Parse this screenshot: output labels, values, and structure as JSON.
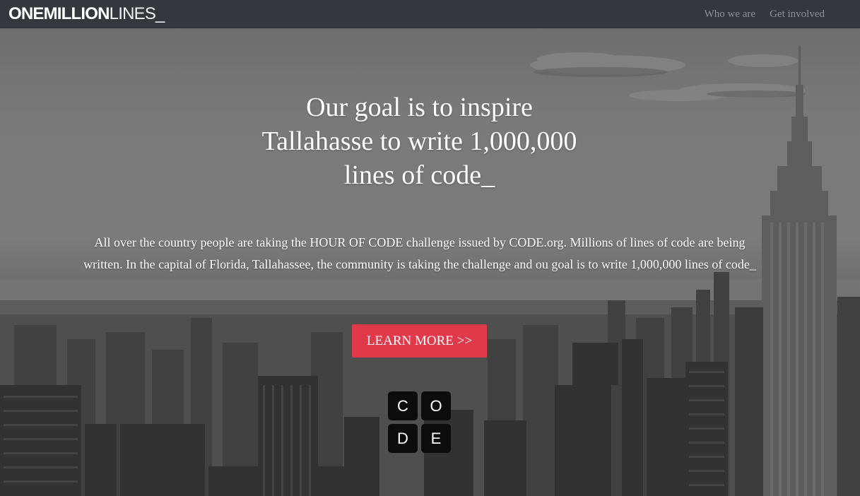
{
  "nav": {
    "brand_bold": "ONEMILLION",
    "brand_thin": "LINES_",
    "links": [
      {
        "label": "Who we are"
      },
      {
        "label": "Get involved"
      }
    ],
    "background": "#34373c"
  },
  "hero": {
    "headline_lines": [
      "Our goal is to inspire",
      "Tallahasse to write 1,000,000",
      "lines of code_"
    ],
    "intro": "All over the country people are taking the HOUR OF CODE challenge issued by CODE.org. Millions of lines of code are being written. In the capital of Florida, Tallahassee, the community is taking the challenge and ou goal is to write 1,000,000 lines of code_",
    "button_label": "LEARN MORE >>",
    "button_color": "#e0394a",
    "code_logo_letters": [
      "C",
      "O",
      "D",
      "E"
    ]
  }
}
